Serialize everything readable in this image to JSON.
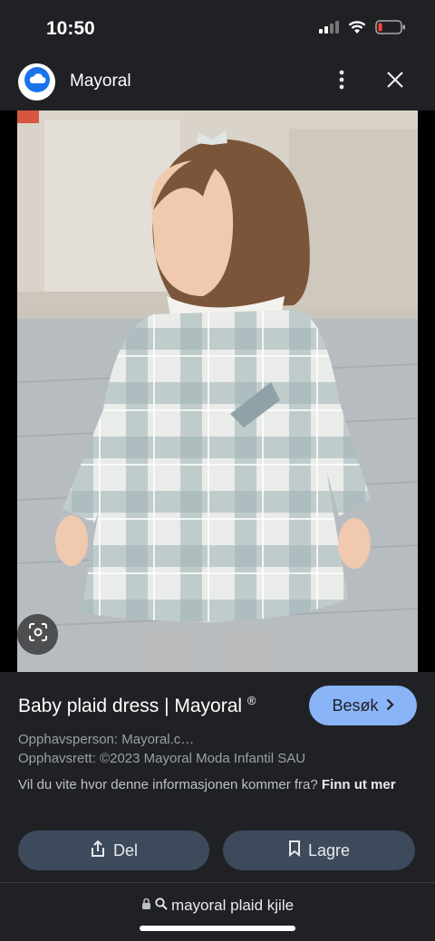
{
  "status_bar": {
    "time": "10:50",
    "icons": [
      "cellular-signal-icon",
      "wifi-icon",
      "battery-low-icon"
    ],
    "battery_color": "#ff453a"
  },
  "header": {
    "site_name": "Mayoral",
    "logo_icon": "cloud-icon",
    "logo_color": "#1a73e8"
  },
  "image": {
    "subject": "photo of a toddler girl wearing a plaid dress"
  },
  "result": {
    "title": "Baby plaid dress | Mayoral",
    "title_mark": "®",
    "visit_label": "Besøk",
    "creator": "Opphavsperson: Mayoral.c…",
    "copyright": "Opphavsrett: ©2023 Mayoral Moda Infantil SAU",
    "source_question": "Vil du vite hvor denne informasjonen kommer fra?",
    "source_link": "Finn ut mer",
    "share_label": "Del",
    "save_label": "Lagre"
  },
  "url_bar": {
    "query": "mayoral plaid kjile"
  },
  "colors": {
    "background": "#202124",
    "accent": "#8ab4f8",
    "button_bg": "#3c4a5c"
  }
}
